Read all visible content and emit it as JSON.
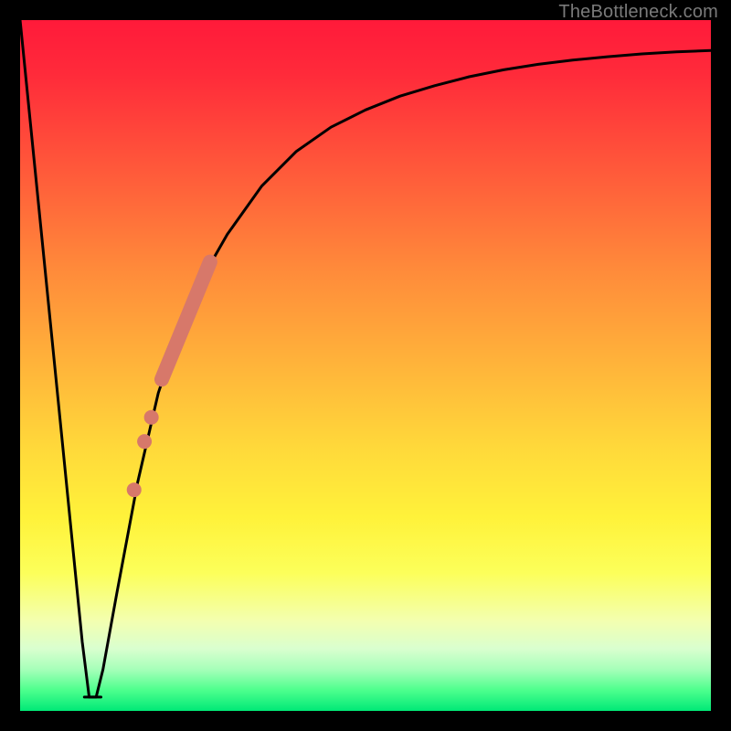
{
  "watermark": "TheBottleneck.com",
  "colors": {
    "page_bg": "#000000",
    "curve_stroke": "#000000",
    "point_fill": "#d7786a",
    "gradient_stops": [
      "#ff1a3a",
      "#ff2b3a",
      "#ff5a3a",
      "#ff8a3a",
      "#ffb43a",
      "#ffd93a",
      "#fff23a",
      "#fcff5a",
      "#f3ffb0",
      "#d9ffcf",
      "#a6ffb9",
      "#4dff8d",
      "#00e977"
    ]
  },
  "chart_data": {
    "type": "line",
    "title": "",
    "xlabel": "",
    "ylabel": "",
    "xlim": [
      0,
      100
    ],
    "ylim": [
      0,
      100
    ],
    "grid": false,
    "series": [
      {
        "name": "bottleneck-curve",
        "x": [
          0,
          3,
          6,
          9,
          10,
          11,
          12,
          14,
          17,
          20,
          23,
          26,
          30,
          35,
          40,
          45,
          50,
          55,
          60,
          65,
          70,
          75,
          80,
          85,
          90,
          95,
          100
        ],
        "y": [
          100,
          70,
          40,
          10,
          2,
          2,
          6,
          17,
          33,
          46,
          55,
          62,
          69,
          76,
          81,
          84.5,
          87,
          89,
          90.5,
          91.8,
          92.8,
          93.6,
          94.2,
          94.7,
          95.1,
          95.4,
          95.6
        ]
      }
    ],
    "points": {
      "name": "highlighted-range",
      "note": "Thick salmon segment plus a few isolated dots along the rising limb",
      "band": {
        "x_start": 20.5,
        "y_start": 48,
        "x_end": 27.5,
        "y_end": 65,
        "thickness_px": 16
      },
      "dots": [
        {
          "x": 19.0,
          "y": 42.5
        },
        {
          "x": 18.0,
          "y": 39.0
        },
        {
          "x": 16.5,
          "y": 32.0
        }
      ],
      "dot_radius_px": 8
    }
  }
}
